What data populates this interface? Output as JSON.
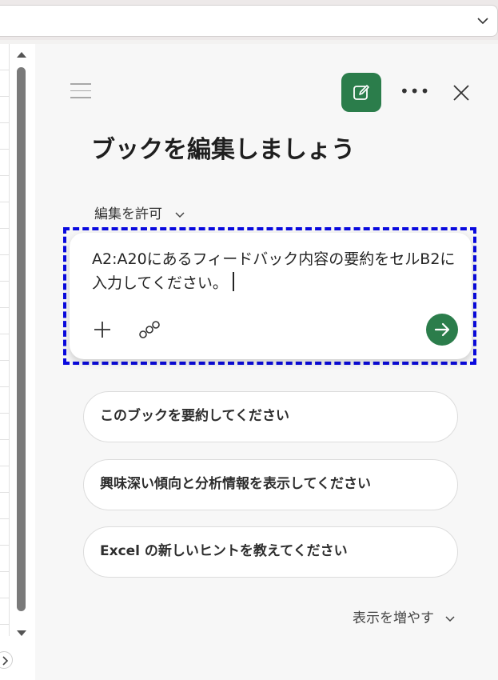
{
  "panel": {
    "title": "ブックを編集しましょう",
    "permission_label": "編集を許可"
  },
  "composer": {
    "text": "A2:A20にあるフィードバック内容の要約をセルB2に入力してください。"
  },
  "suggestions": [
    "このブックを要約してください",
    "興味深い傾向と分析情報を表示してください",
    "Excel の新しいヒントを教えてください"
  ],
  "show_more_label": "表示を増やす",
  "colors": {
    "accent_green": "#2b7d4b",
    "highlight_blue": "#0a0adf"
  },
  "icons": {
    "topbar": "chevron-down-icon",
    "menu": "hamburger-icon",
    "new_chat": "new-chat-icon",
    "more": "more-icon",
    "close": "close-icon",
    "attach": "plus-icon",
    "reference": "link-icon",
    "send": "send-arrow-icon"
  }
}
